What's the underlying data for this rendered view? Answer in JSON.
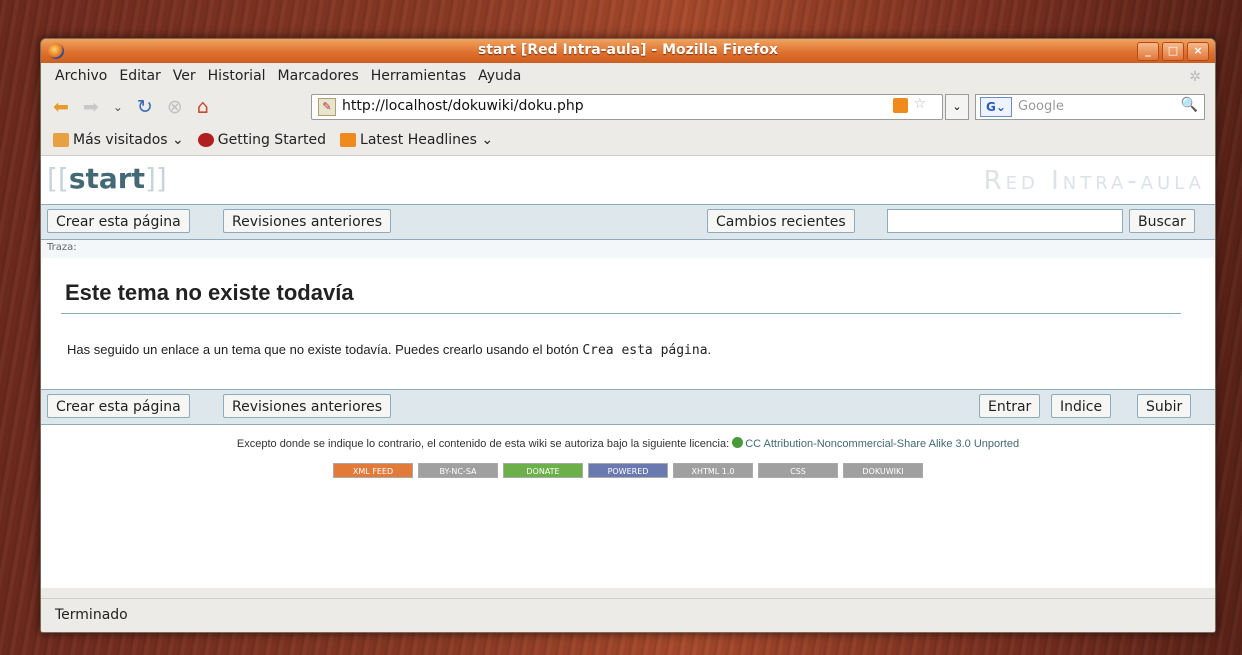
{
  "window": {
    "title": "start [Red Intra-aula] - Mozilla Firefox"
  },
  "menu": [
    "Archivo",
    "Editar",
    "Ver",
    "Historial",
    "Marcadores",
    "Herramientas",
    "Ayuda"
  ],
  "nav": {
    "url": "http://localhost/dokuwiki/doku.php",
    "search_placeholder": "Google",
    "engine_icon": "G"
  },
  "bookmarks": [
    {
      "label": "Más visitados",
      "icon": "folder-icon",
      "color": "#e8a040"
    },
    {
      "label": "Getting Started",
      "icon": "firefox-icon",
      "color": "#b02020"
    },
    {
      "label": "Latest Headlines",
      "icon": "rss-icon",
      "color": "#f08a1c"
    }
  ],
  "wiki": {
    "pagename": "start",
    "site_logo": "Red Intra-aula",
    "top_buttons": {
      "create": "Crear esta página",
      "revisions": "Revisiones anteriores",
      "recent": "Cambios recientes",
      "search": "Buscar"
    },
    "trace_label": "Traza:",
    "heading": "Este tema no existe todavía",
    "body_prefix": "Has seguido un enlace a un tema que no existe todavía. Puedes crearlo usando el botón",
    "body_code": "Crea esta página",
    "body_suffix": ".",
    "bottom_buttons": {
      "create": "Crear esta página",
      "revisions": "Revisiones anteriores",
      "login": "Entrar",
      "index": "Indice",
      "up": "Subir"
    },
    "license_prefix": "Excepto donde se indique lo contrario, el contenido de esta wiki se autoriza bajo la siguiente licencia:",
    "license_link": "CC Attribution-Noncommercial-Share Alike 3.0 Unported",
    "badges": [
      {
        "label": "XML FEED",
        "color": "#e27a3a"
      },
      {
        "label": "BY-NC-SA",
        "color": "#a0a0a0"
      },
      {
        "label": "DONATE",
        "color": "#6cb04a"
      },
      {
        "label": "POWERED",
        "color": "#6a7ab0"
      },
      {
        "label": "XHTML 1.0",
        "color": "#a0a0a0"
      },
      {
        "label": "CSS",
        "color": "#a0a0a0"
      },
      {
        "label": "DOKUWIKI",
        "color": "#a0a0a0"
      }
    ]
  },
  "status": "Terminado"
}
